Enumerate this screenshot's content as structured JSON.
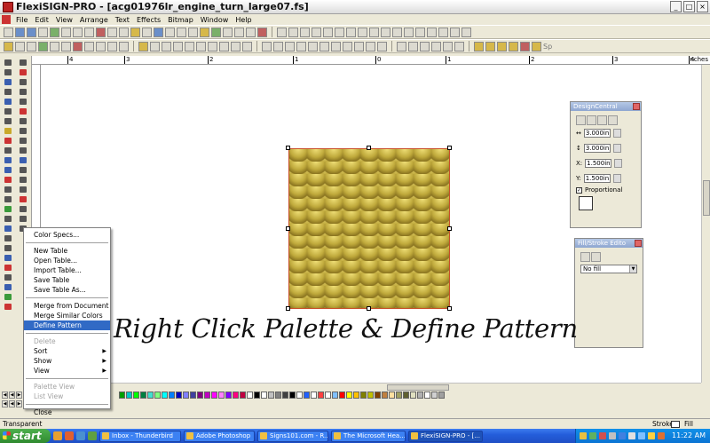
{
  "window": {
    "title": "FlexiSIGN-PRO - [acg01976lr_engine_turn_large07.fs]"
  },
  "menubar": {
    "items": [
      "File",
      "Edit",
      "View",
      "Arrange",
      "Text",
      "Effects",
      "Bitmap",
      "Window",
      "Help"
    ]
  },
  "toolbar2": {
    "sp_label": "Sp"
  },
  "ruler": {
    "ticks": [
      "4",
      "3",
      "2",
      "1",
      "0",
      "1",
      "2",
      "3",
      "4"
    ],
    "units": "inches"
  },
  "design_central": {
    "title": "DesignCentral",
    "width": "3.000in",
    "height": "3.000in",
    "x": "1.500in",
    "y": "1.500in",
    "x_label": "X:",
    "y_label": "Y:",
    "proportional_label": "Proportional",
    "proportional_checked": true
  },
  "fill_stroke": {
    "title": "Fill/Stroke Edito",
    "fill_value": "No fill"
  },
  "context_menu": {
    "items": [
      {
        "label": "Color Specs...",
        "enabled": true
      },
      {
        "separator": true
      },
      {
        "label": "New Table",
        "enabled": true
      },
      {
        "label": "Open Table...",
        "enabled": true
      },
      {
        "label": "Import Table...",
        "enabled": true
      },
      {
        "label": "Save Table",
        "enabled": true
      },
      {
        "label": "Save Table As...",
        "enabled": true
      },
      {
        "separator": true
      },
      {
        "label": "Merge from Document",
        "enabled": true
      },
      {
        "label": "Merge Similar Colors",
        "enabled": true
      },
      {
        "label": "Define Pattern",
        "enabled": true,
        "highlighted": true
      },
      {
        "separator": true
      },
      {
        "label": "Delete",
        "enabled": false
      },
      {
        "label": "Sort",
        "enabled": true,
        "submenu": true
      },
      {
        "label": "Show",
        "enabled": true,
        "submenu": true
      },
      {
        "label": "View",
        "enabled": true,
        "submenu": true
      },
      {
        "separator": true
      },
      {
        "label": "Palette View",
        "enabled": false
      },
      {
        "label": "List View",
        "enabled": false
      },
      {
        "separator": true
      },
      {
        "label": "Close",
        "enabled": true
      }
    ]
  },
  "caption": {
    "text": "Right Click Palette & Define Pattern"
  },
  "palette": {
    "swatches": [
      "#00a000",
      "#00c8c8",
      "#00ff00",
      "#008040",
      "#40e0d0",
      "#80ff80",
      "#00ffff",
      "#0080ff",
      "#0000c0",
      "#8080ff",
      "#4040a0",
      "#800080",
      "#c000c0",
      "#ff00ff",
      "#ff80ff",
      "#8000ff",
      "#ff0080",
      "#c00040",
      "#ffffff",
      "#000000",
      "#ffffff",
      "#c0c0c0",
      "#808080",
      "#404040",
      "#000000",
      "#ffffff",
      "#2060ff",
      "#ffffff",
      "#ff4040",
      "#ffffff",
      "#80c0ff",
      "#ff0000",
      "#ffff00",
      "#ffc000",
      "#808000",
      "#c0c000",
      "#804000",
      "#c08040",
      "#ffe0a0",
      "#a0a060",
      "#606030",
      "#e0e0c0",
      "#b0b0b0",
      "#ffffff",
      "#d0d0d0",
      "#a0a0a0"
    ]
  },
  "status": {
    "fill_mode": "Transparent",
    "stroke_label": "Stroke",
    "fill_label": "Fill"
  },
  "taskbar": {
    "start_label": "start",
    "tasks": [
      {
        "label": "Inbox - Thunderbird",
        "active": false
      },
      {
        "label": "Adobe Photoshop",
        "active": false
      },
      {
        "label": "Signs101.com - R...",
        "active": false
      },
      {
        "label": "The Microsoft Hea...",
        "active": false
      },
      {
        "label": "FlexiSIGN-PRO - [...",
        "active": true
      }
    ],
    "clock": "11:22 AM"
  }
}
